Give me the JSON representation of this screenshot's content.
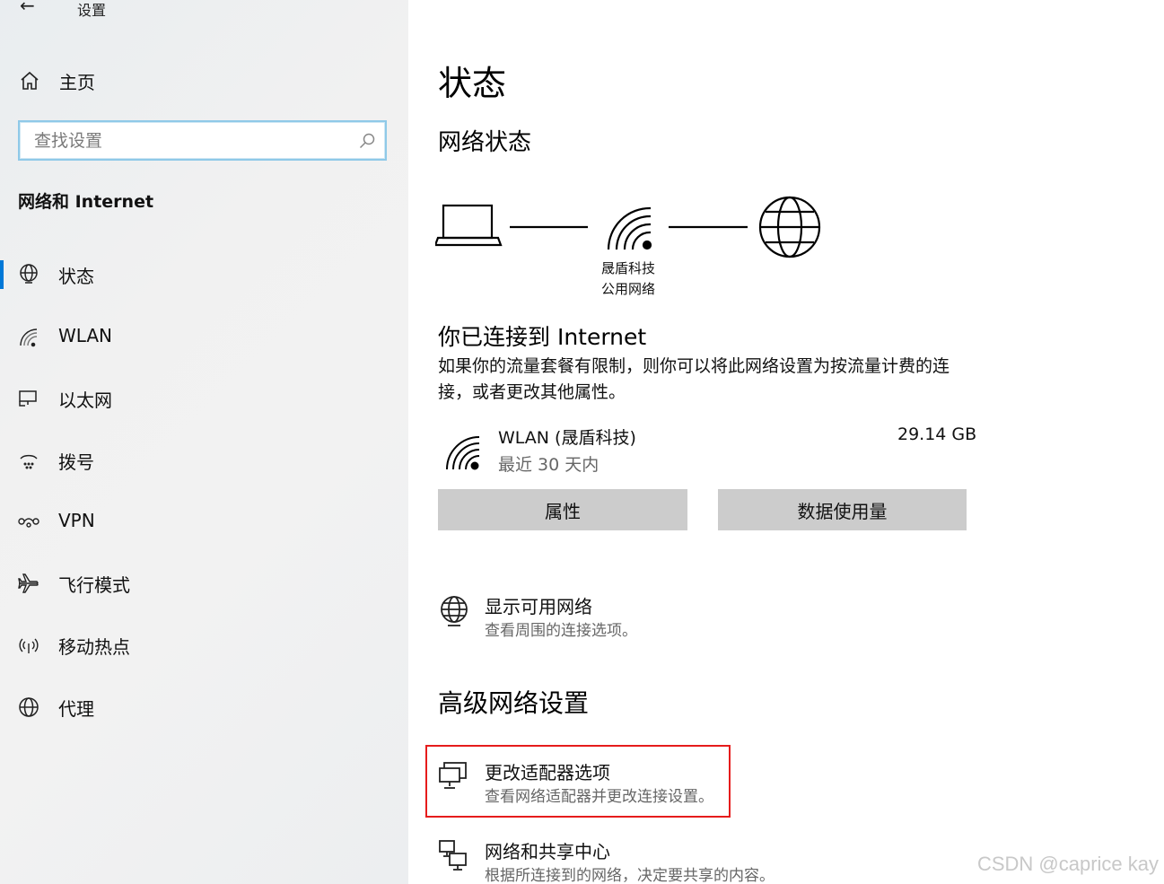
{
  "window": {
    "app_title": "设置",
    "back_icon": "back-arrow-icon"
  },
  "sidebar": {
    "home_label": "主页",
    "search": {
      "placeholder": "查找设置",
      "value": ""
    },
    "section_title": "网络和 Internet",
    "items": [
      {
        "label": "状态",
        "icon": "status-globe-icon",
        "active": true
      },
      {
        "label": "WLAN",
        "icon": "wifi-icon",
        "active": false
      },
      {
        "label": "以太网",
        "icon": "ethernet-icon",
        "active": false
      },
      {
        "label": "拨号",
        "icon": "dialup-icon",
        "active": false
      },
      {
        "label": "VPN",
        "icon": "vpn-icon",
        "active": false
      },
      {
        "label": "飞行模式",
        "icon": "airplane-icon",
        "active": false
      },
      {
        "label": "移动热点",
        "icon": "hotspot-icon",
        "active": false
      },
      {
        "label": "代理",
        "icon": "proxy-globe-icon",
        "active": false
      }
    ]
  },
  "main": {
    "title": "状态",
    "network_status_heading": "网络状态",
    "network": {
      "name_line1": "晟盾科技",
      "name_line2": "公用网络"
    },
    "connected_title": "你已连接到 Internet",
    "connected_desc": "如果你的流量套餐有限制，则你可以将此网络设置为按流量计费的连接，或者更改其他属性。",
    "wlan_entry": {
      "name": "WLAN (晟盾科技)",
      "period": "最近 30 天内",
      "usage": "29.14 GB"
    },
    "buttons": {
      "properties": "属性",
      "data_usage": "数据使用量"
    },
    "show_networks": {
      "title": "显示可用网络",
      "desc": "查看周围的连接选项。"
    },
    "advanced_heading": "高级网络设置",
    "adapter_options": {
      "title": "更改适配器选项",
      "desc": "查看网络适配器并更改连接设置。"
    },
    "sharing_center": {
      "title": "网络和共享中心",
      "desc": "根据所连接到的网络，决定要共享的内容。"
    }
  },
  "highlight_color": "#e61c1c",
  "accent_color": "#0078d7",
  "watermark": "CSDN @caprice kay"
}
